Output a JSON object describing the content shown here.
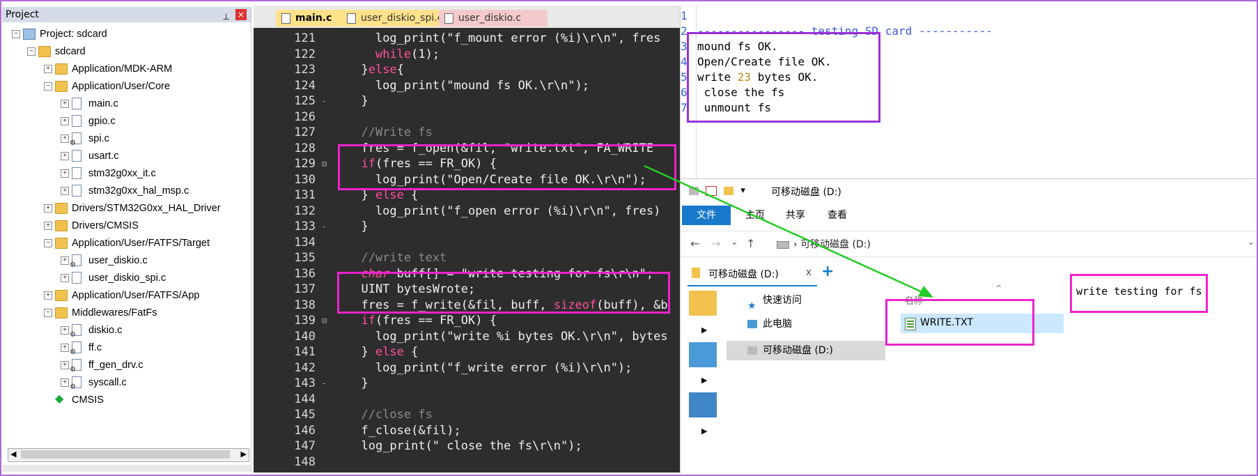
{
  "project": {
    "title": "Project",
    "pin": "p",
    "close": "×",
    "tree": [
      {
        "label": "Project: sdcard",
        "icon": "project-icon",
        "depth": 0,
        "exp": "−"
      },
      {
        "label": "sdcard",
        "icon": "target-folder-icon",
        "depth": 1,
        "exp": "−"
      },
      {
        "label": "Application/MDK-ARM",
        "icon": "folder-icon",
        "depth": 2,
        "exp": "+"
      },
      {
        "label": "Application/User/Core",
        "icon": "folder-icon",
        "depth": 2,
        "exp": "−"
      },
      {
        "label": "main.c",
        "icon": "c-file-icon",
        "depth": 3,
        "exp": "+"
      },
      {
        "label": "gpio.c",
        "icon": "c-file-icon",
        "depth": 3,
        "exp": "+"
      },
      {
        "label": "spi.c",
        "icon": "c-file-gear-icon",
        "depth": 3,
        "exp": "+"
      },
      {
        "label": "usart.c",
        "icon": "c-file-icon",
        "depth": 3,
        "exp": "+"
      },
      {
        "label": "stm32g0xx_it.c",
        "icon": "c-file-icon",
        "depth": 3,
        "exp": "+"
      },
      {
        "label": "stm32g0xx_hal_msp.c",
        "icon": "c-file-icon",
        "depth": 3,
        "exp": "+"
      },
      {
        "label": "Drivers/STM32G0xx_HAL_Driver",
        "icon": "folder-icon",
        "depth": 2,
        "exp": "+"
      },
      {
        "label": "Drivers/CMSIS",
        "icon": "folder-icon",
        "depth": 2,
        "exp": "+"
      },
      {
        "label": "Application/User/FATFS/Target",
        "icon": "folder-icon",
        "depth": 2,
        "exp": "−"
      },
      {
        "label": "user_diskio.c",
        "icon": "c-file-gear-icon",
        "depth": 3,
        "exp": "+"
      },
      {
        "label": "user_diskio_spi.c",
        "icon": "c-file-icon",
        "depth": 3,
        "exp": "+"
      },
      {
        "label": "Application/User/FATFS/App",
        "icon": "folder-icon",
        "depth": 2,
        "exp": "+"
      },
      {
        "label": "Middlewares/FatFs",
        "icon": "folder-icon",
        "depth": 2,
        "exp": "−"
      },
      {
        "label": "diskio.c",
        "icon": "c-file-gear-icon",
        "depth": 3,
        "exp": "+"
      },
      {
        "label": "ff.c",
        "icon": "c-file-gear-icon",
        "depth": 3,
        "exp": "+"
      },
      {
        "label": "ff_gen_drv.c",
        "icon": "c-file-gear-icon",
        "depth": 3,
        "exp": "+"
      },
      {
        "label": "syscall.c",
        "icon": "c-file-gear-icon",
        "depth": 3,
        "exp": "+"
      },
      {
        "label": "CMSIS",
        "icon": "cmsis-icon",
        "depth": 2,
        "exp": ""
      }
    ]
  },
  "editor": {
    "tabs": [
      {
        "label": "main.c",
        "active": true
      },
      {
        "label": "user_diskio_spi.c",
        "active": false
      },
      {
        "label": "user_diskio.c",
        "active": false
      }
    ],
    "lines": [
      {
        "n": "121",
        "fold": "",
        "segs": [
          [
            "    ",
            ""
          ],
          [
            "log_print(\"f_mount error (%i)\\r\\n\", fres",
            ""
          ]
        ]
      },
      {
        "n": "122",
        "fold": "",
        "segs": [
          [
            "    ",
            ""
          ],
          [
            "while",
            "kw"
          ],
          [
            "(1);",
            ""
          ]
        ]
      },
      {
        "n": "123",
        "fold": "",
        "segs": [
          [
            "  }",
            ""
          ],
          [
            "else",
            "kw"
          ],
          [
            "{",
            ""
          ]
        ]
      },
      {
        "n": "124",
        "fold": "",
        "segs": [
          [
            "    log_print(\"mound fs OK.\\r\\n\");",
            ""
          ]
        ]
      },
      {
        "n": "125",
        "fold": "-",
        "segs": [
          [
            "  }",
            ""
          ]
        ]
      },
      {
        "n": "126",
        "fold": "",
        "segs": [
          [
            "",
            ""
          ]
        ]
      },
      {
        "n": "127",
        "fold": "",
        "segs": [
          [
            "  //Write fs",
            "cm"
          ]
        ]
      },
      {
        "n": "128",
        "fold": "",
        "segs": [
          [
            "  fres = f_open(&fil, \"write.txt\", FA_WRITE",
            ""
          ]
        ]
      },
      {
        "n": "129",
        "fold": "⊟",
        "segs": [
          [
            "  ",
            ""
          ],
          [
            "if",
            "kw"
          ],
          [
            "(fres == FR_OK) {",
            ""
          ]
        ]
      },
      {
        "n": "130",
        "fold": "",
        "segs": [
          [
            "    log_print(\"Open/Create file OK.\\r\\n\");",
            ""
          ]
        ]
      },
      {
        "n": "131",
        "fold": "",
        "segs": [
          [
            "  } ",
            ""
          ],
          [
            "else",
            "kw"
          ],
          [
            " {",
            ""
          ]
        ]
      },
      {
        "n": "132",
        "fold": "",
        "segs": [
          [
            "    log_print(\"f_open error (%i)\\r\\n\", fres)",
            ""
          ]
        ]
      },
      {
        "n": "133",
        "fold": "-",
        "segs": [
          [
            "  }",
            ""
          ]
        ]
      },
      {
        "n": "134",
        "fold": "",
        "segs": [
          [
            "",
            ""
          ]
        ]
      },
      {
        "n": "135",
        "fold": "",
        "segs": [
          [
            "  //write text",
            "cm"
          ]
        ]
      },
      {
        "n": "136",
        "fold": "",
        "segs": [
          [
            "  ",
            ""
          ],
          [
            "char",
            "kwi"
          ],
          [
            " buff[] = \"write testing for fs\\r\\n\";",
            ""
          ]
        ]
      },
      {
        "n": "137",
        "fold": "",
        "segs": [
          [
            "  UINT bytesWrote;",
            ""
          ]
        ]
      },
      {
        "n": "138",
        "fold": "",
        "segs": [
          [
            "  fres = f_write(&fil, buff, ",
            ""
          ],
          [
            "sizeof",
            "kw"
          ],
          [
            "(buff), &b",
            ""
          ]
        ]
      },
      {
        "n": "139",
        "fold": "⊟",
        "segs": [
          [
            "  ",
            ""
          ],
          [
            "if",
            "kw"
          ],
          [
            "(fres == FR_OK) {",
            ""
          ]
        ]
      },
      {
        "n": "140",
        "fold": "",
        "segs": [
          [
            "    log_print(\"write %i bytes OK.\\r\\n\", bytes",
            ""
          ]
        ]
      },
      {
        "n": "141",
        "fold": "",
        "segs": [
          [
            "  } ",
            ""
          ],
          [
            "else",
            "kw"
          ],
          [
            " {",
            ""
          ]
        ]
      },
      {
        "n": "142",
        "fold": "",
        "segs": [
          [
            "    log_print(\"f_write error (%i)\\r\\n\");",
            ""
          ]
        ]
      },
      {
        "n": "143",
        "fold": "-",
        "segs": [
          [
            "  }",
            ""
          ]
        ]
      },
      {
        "n": "144",
        "fold": "",
        "segs": [
          [
            "",
            ""
          ]
        ]
      },
      {
        "n": "145",
        "fold": "",
        "segs": [
          [
            "  //close fs",
            "cm"
          ]
        ]
      },
      {
        "n": "146",
        "fold": "",
        "segs": [
          [
            "  f_close(&fil);",
            ""
          ]
        ]
      },
      {
        "n": "147",
        "fold": "",
        "segs": [
          [
            "  log_print(\" close the fs\\r\\n\");",
            ""
          ]
        ]
      },
      {
        "n": "148",
        "fold": "",
        "segs": [
          [
            "",
            ""
          ]
        ]
      }
    ]
  },
  "terminal": {
    "line_numbers": [
      "1",
      "2",
      "3",
      "4",
      "5",
      "6",
      "7"
    ],
    "header": "---------------- testing SD card -----------",
    "lines": [
      {
        "text": "mound fs OK."
      },
      {
        "text": "Open/Create file OK."
      },
      {
        "pre": "write ",
        "num": "23",
        "post": " bytes OK."
      },
      {
        "text": " close the fs"
      },
      {
        "text": " unmount fs"
      }
    ]
  },
  "explorer": {
    "title": "可移动磁盘 (D:)",
    "ribbon_tabs": [
      "文件",
      "主页",
      "共享",
      "查看"
    ],
    "address": "可移动磁盘 (D:)",
    "tab_label": "可移动磁盘 (D:)",
    "tab_close": "x",
    "nav": {
      "back": "←",
      "forward": "→",
      "recent": "⌄",
      "up": "↑"
    },
    "nav_items": [
      {
        "label": "快速访问",
        "icon": "star-icon"
      },
      {
        "label": "此电脑",
        "icon": "computer-icon"
      },
      {
        "label": "可移动磁盘 (D:)",
        "icon": "drive-icon",
        "selected": true
      }
    ],
    "column_header": "名称",
    "files": [
      {
        "name": "WRITE.TXT",
        "icon": "text-file-icon"
      }
    ],
    "file_content": "write testing for fs"
  },
  "colors": {
    "highlight_magenta": "#ee22cc",
    "highlight_purple": "#9b30d8",
    "arrow_green": "#22cc22",
    "editor_bg": "#2d2d2d",
    "keyword": "#ff4f9e"
  }
}
